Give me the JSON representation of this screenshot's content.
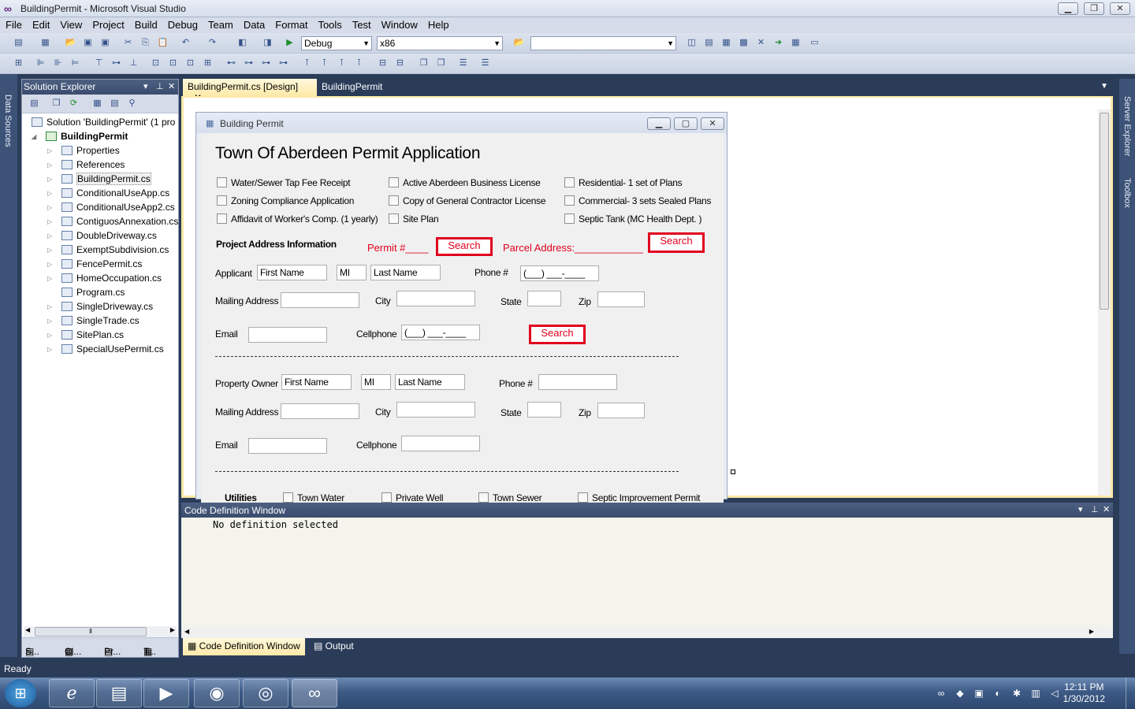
{
  "window": {
    "title": "BuildingPermit - Microsoft Visual Studio"
  },
  "menu": [
    "File",
    "Edit",
    "View",
    "Project",
    "Build",
    "Debug",
    "Team",
    "Data",
    "Format",
    "Tools",
    "Test",
    "Window",
    "Help"
  ],
  "toolbar": {
    "config": "Debug",
    "platform": "x86",
    "find": ""
  },
  "left_rail": {
    "data_sources": "Data Sources"
  },
  "right_rail": {
    "server_explorer": "Server Explorer",
    "toolbox": "Toolbox"
  },
  "solution_explorer": {
    "title": "Solution Explorer",
    "solution": "Solution 'BuildingPermit' (1 pro",
    "project": "BuildingPermit",
    "items": [
      "Properties",
      "References",
      "BuildingPermit.cs",
      "ConditionalUseApp.cs",
      "ConditionalUseApp2.cs",
      "ContiguosAnnexation.cs",
      "DoubleDriveway.cs",
      "ExemptSubdivision.cs",
      "FencePermit.cs",
      "HomeOccupation.cs",
      "Program.cs",
      "SingleDriveway.cs",
      "SingleTrade.cs",
      "SitePlan.cs",
      "SpecialUsePermit.cs"
    ],
    "bottom_tabs": [
      "S...",
      "Cl...",
      "Pr...",
      "T..."
    ]
  },
  "doc_tabs": {
    "design": "BuildingPermit.cs [Design]",
    "code": "BuildingPermit"
  },
  "form": {
    "caption": "Building Permit",
    "heading": "Town Of Aberdeen Permit Application",
    "checkboxes": {
      "c1": "Water/Sewer Tap Fee Receipt",
      "c2": "Zoning Compliance Application",
      "c3": "Affidavit of Worker's Comp. (1 yearly)",
      "c4": "Active Aberdeen Business License",
      "c5": "Copy of General Contractor License",
      "c6": "Site Plan",
      "c7": "Residential- 1 set of Plans",
      "c8": "Commercial- 3 sets Sealed Plans",
      "c9": "Septic Tank (MC Health Dept. )"
    },
    "project_address": "Project Address Information",
    "permit_label": "Permit #____",
    "parcel_label": "Parcel Address:____________",
    "search": "Search",
    "applicant": {
      "label": "Applicant",
      "first": "First Name",
      "mi": "MI",
      "last": "Last Name",
      "phone_label": "Phone #",
      "phone": "(___) ___-____",
      "mailing": "Mailing Address",
      "city": "City",
      "state": "State",
      "zip": "Zip",
      "email": "Email",
      "cell": "Cellphone",
      "cell_value": "(___) ___-____"
    },
    "owner": {
      "label": "Property Owner",
      "first": "First Name",
      "mi": "MI",
      "last": "Last Name",
      "phone_label": "Phone #",
      "mailing": "Mailing Address",
      "city": "City",
      "state": "State",
      "zip": "Zip",
      "email": "Email",
      "cell": "Cellphone"
    },
    "utilities": {
      "label": "Utilities",
      "town_water": "Town Water",
      "private_well": "Private Well",
      "town_sewer": "Town Sewer",
      "septic": "Septic Improvement Permit"
    }
  },
  "code_definition": {
    "title": "Code Definition Window",
    "text": "No definition selected"
  },
  "bottom_tabs": {
    "code_def": "Code Definition Window",
    "output": "Output"
  },
  "status": "Ready",
  "clock": {
    "time": "12:11 PM",
    "date": "1/30/2012"
  }
}
